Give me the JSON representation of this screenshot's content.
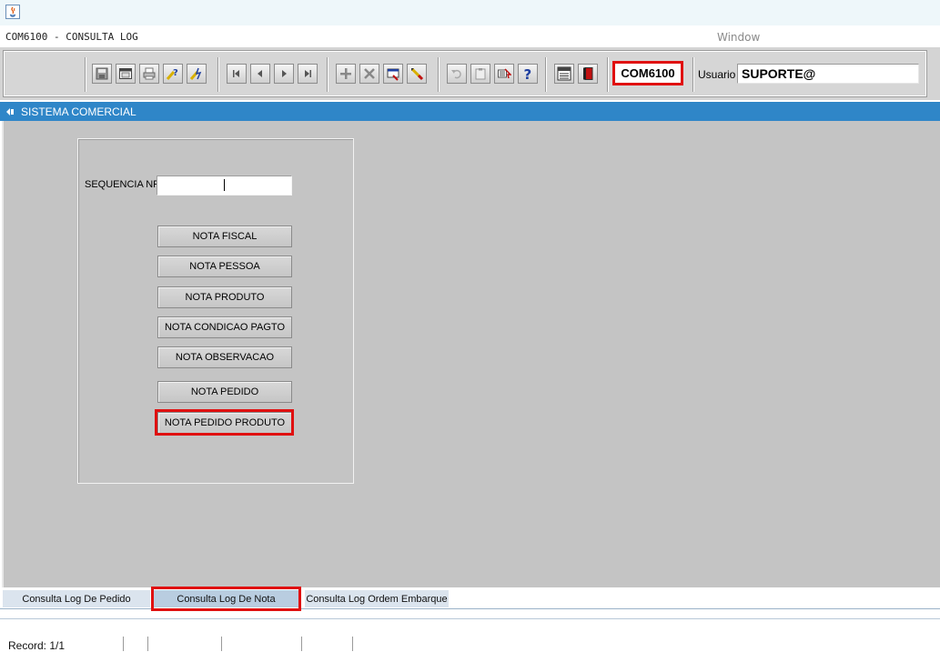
{
  "window": {
    "title": "COM6100 - CONSULTA LOG",
    "menu_window": "Window"
  },
  "toolbar": {
    "form_code": "COM6100",
    "usuario_label": "Usuario",
    "usuario_value": "SUPORTE@",
    "buttons": [
      "save-icon",
      "window-icon",
      "print-icon",
      "query-help-icon",
      "execute-query-icon",
      "first-record-icon",
      "previous-record-icon",
      "next-record-icon",
      "last-record-icon",
      "insert-record-icon",
      "delete-record-icon",
      "clear-record-icon",
      "edit-record-icon",
      "undo-icon",
      "clipboard-icon",
      "list-values-icon",
      "help-icon",
      "menu-icon",
      "exit-icon"
    ]
  },
  "header": {
    "title": "SISTEMA COMERCIAL"
  },
  "form": {
    "sequencia_label": "SEQUENCIA NF",
    "sequencia_value": "",
    "buttons": {
      "nota_fiscal": "NOTA FISCAL",
      "nota_pessoa": "NOTA PESSOA",
      "nota_produto": "NOTA PRODUTO",
      "nota_condicao_pagto": "NOTA CONDICAO PAGTO",
      "nota_observacao": "NOTA OBSERVACAO",
      "nota_pedido": "NOTA PEDIDO",
      "nota_pedido_produto": "NOTA PEDIDO PRODUTO"
    }
  },
  "tabs": [
    {
      "label": "Consulta Log De Pedido",
      "active": false
    },
    {
      "label": "Consulta Log De Nota",
      "active": true
    },
    {
      "label": "Consulta Log Ordem Embarque",
      "active": false
    }
  ],
  "status": {
    "record": "Record: 1/1"
  },
  "colors": {
    "header_blue": "#2f86c8",
    "highlight_red": "#e01010",
    "canvas_gray": "#c4c4c4"
  }
}
